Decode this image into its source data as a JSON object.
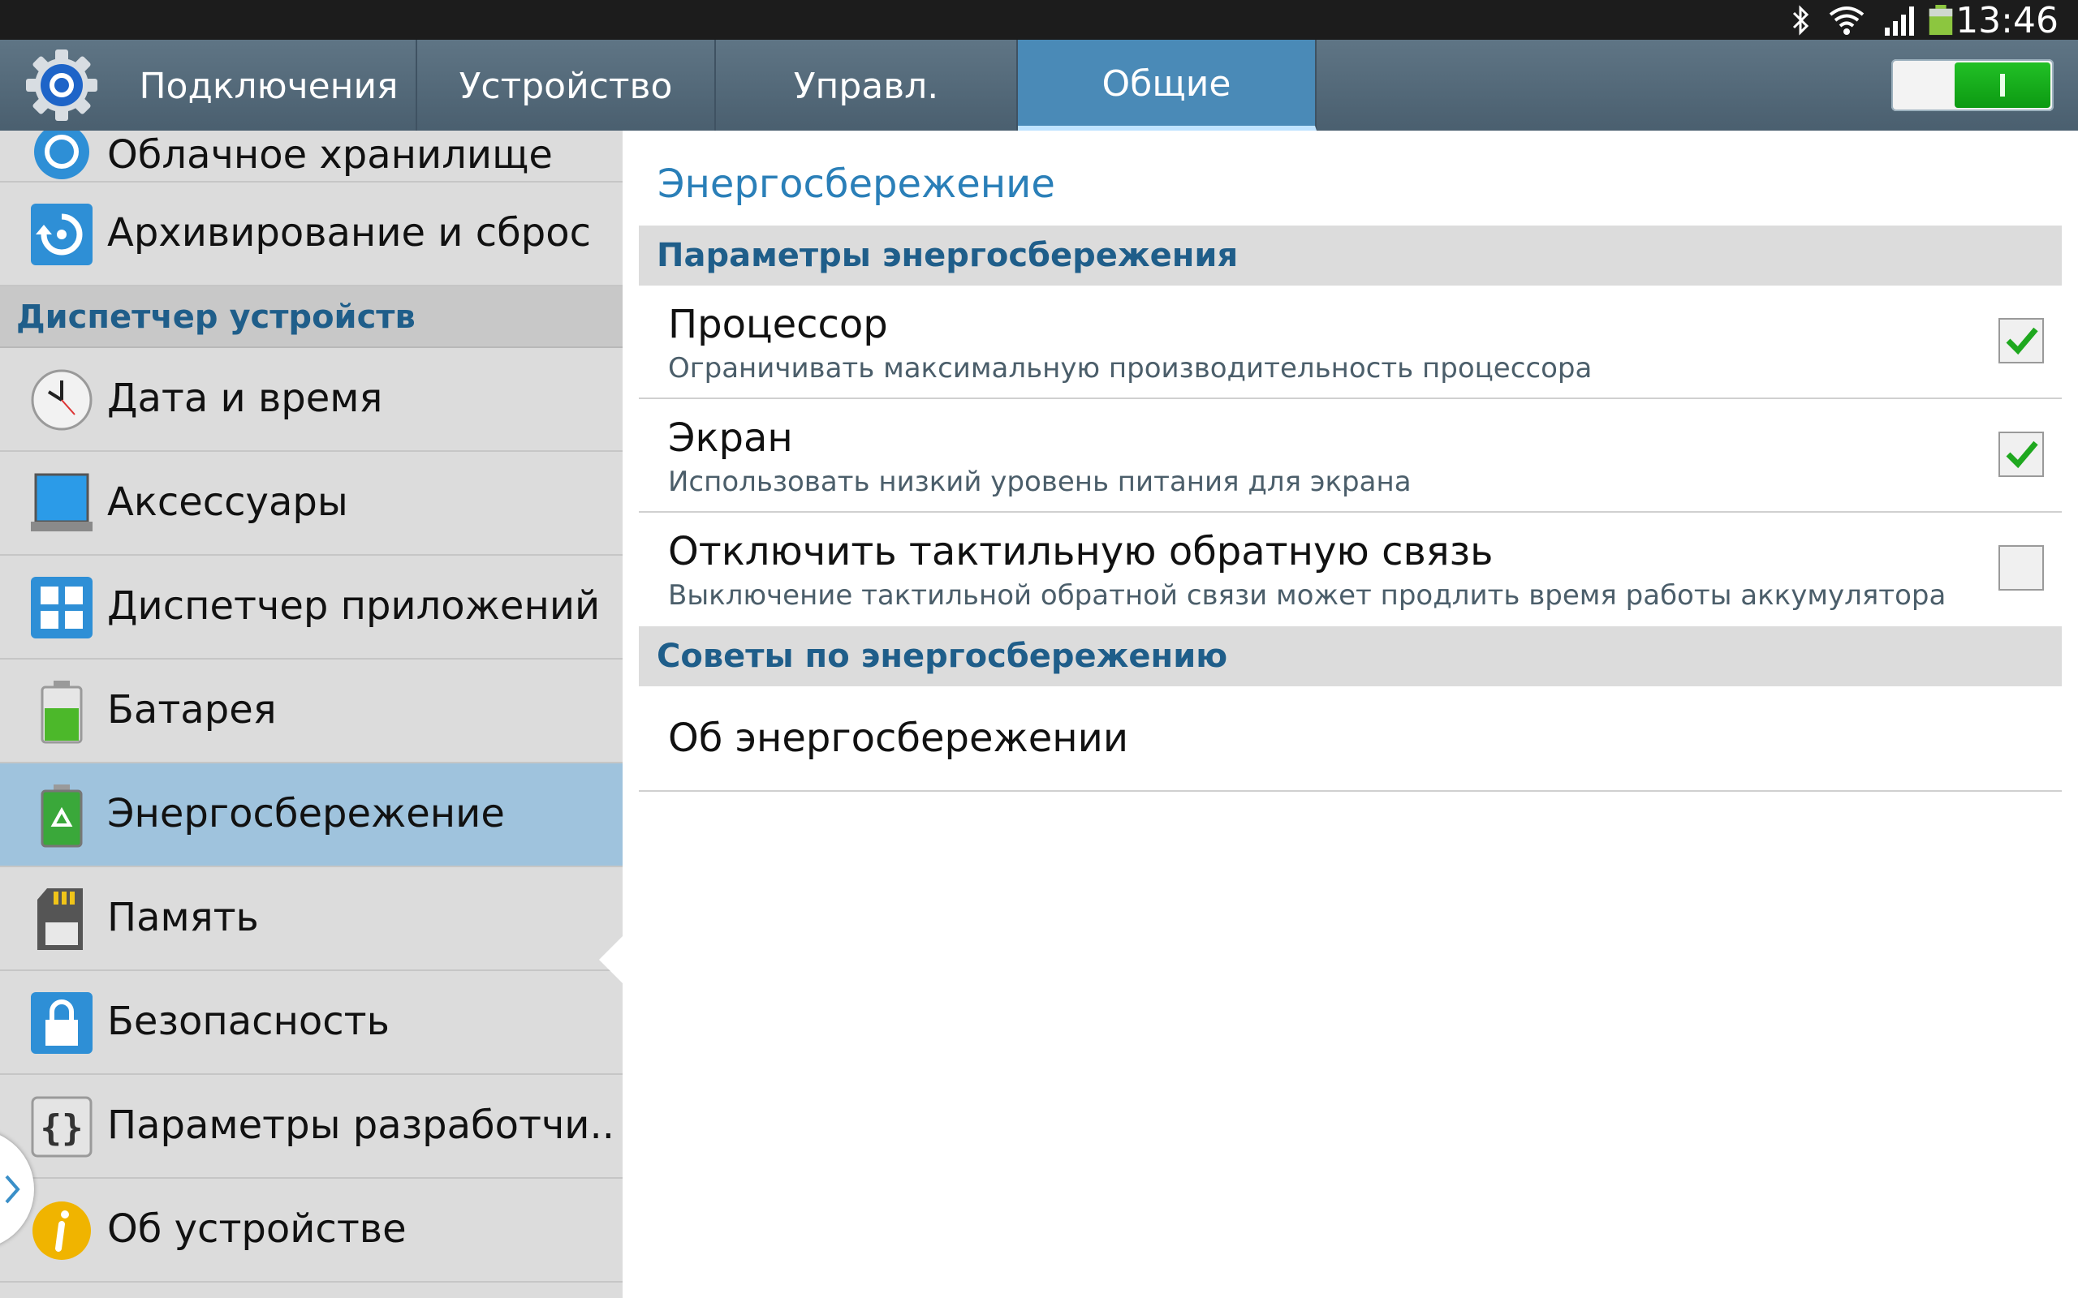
{
  "status_bar": {
    "time": "13:46",
    "icons": [
      "bluetooth-icon",
      "wifi-icon",
      "signal-icon",
      "battery-icon"
    ]
  },
  "tabs": [
    {
      "label": "Подключения",
      "active": false
    },
    {
      "label": "Устройство",
      "active": false
    },
    {
      "label": "Управл.",
      "active": false
    },
    {
      "label": "Общие",
      "active": true
    }
  ],
  "master_switch": {
    "state": "on"
  },
  "sidebar": {
    "partial_item": "Облачное хранилище",
    "backup_item": "Архивирование и сброс",
    "section_header": "Диспетчер устройств",
    "items": [
      {
        "label": "Дата и время",
        "icon": "clock-icon"
      },
      {
        "label": "Аксессуары",
        "icon": "accessory-icon"
      },
      {
        "label": "Диспетчер приложений",
        "icon": "apps-grid-icon"
      },
      {
        "label": "Батарея",
        "icon": "battery-icon"
      },
      {
        "label": "Энергосбережение",
        "icon": "power-saving-icon",
        "active": true
      },
      {
        "label": "Память",
        "icon": "sd-card-icon"
      },
      {
        "label": "Безопасность",
        "icon": "lock-icon"
      },
      {
        "label": "Параметры разработчи..",
        "icon": "braces-icon"
      },
      {
        "label": "Об устройстве",
        "icon": "info-icon"
      }
    ]
  },
  "content": {
    "title": "Энергосбережение",
    "section1": "Параметры энергосбережения",
    "options": [
      {
        "title": "Процессор",
        "summary": "Ограничивать максимальную производительность процессора",
        "checked": true
      },
      {
        "title": "Экран",
        "summary": "Использовать низкий уровень питания для экрана",
        "checked": true
      },
      {
        "title": "Отключить тактильную обратную связь",
        "summary": "Выключение тактильной обратной связи может продлить время работы аккумулятора",
        "checked": false
      }
    ],
    "section2": "Советы по энергосбережению",
    "about": "Об энергосбережении"
  },
  "colors": {
    "accent": "#2a7fb8",
    "section_text": "#1f5e8a",
    "tab_active": "#4a8ab7",
    "toggle_on": "#17a91c",
    "check": "#1fa81f"
  }
}
